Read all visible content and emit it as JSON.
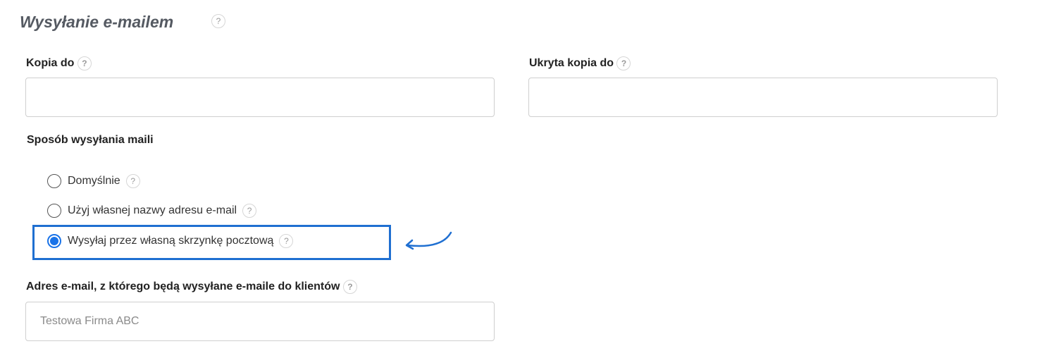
{
  "section": {
    "title": "Wysyłanie e-mailem",
    "help": "?"
  },
  "cc": {
    "label": "Kopia do",
    "help": "?",
    "value": ""
  },
  "bcc": {
    "label": "Ukryta kopia do",
    "help": "?",
    "value": ""
  },
  "sending_method": {
    "label": "Sposób wysyłania maili",
    "options": [
      {
        "label": "Domyślnie",
        "help": "?",
        "checked": false
      },
      {
        "label": "Użyj własnej nazwy adresu e-mail",
        "help": "?",
        "checked": false
      },
      {
        "label": "Wysyłaj przez własną skrzynkę pocztową",
        "help": "?",
        "checked": true
      }
    ]
  },
  "sender_email": {
    "label": "Adres e-mail, z którego będą wysyłane e-maile do klientów",
    "help": "?",
    "placeholder": "Testowa Firma ABC"
  },
  "annotation": {
    "highlight_color": "#1f6fd1",
    "arrow_icon": "curved-arrow-left-icon"
  },
  "colors": {
    "accent": "#1a73e8",
    "title": "#555a62",
    "border": "#cfcfcf"
  }
}
